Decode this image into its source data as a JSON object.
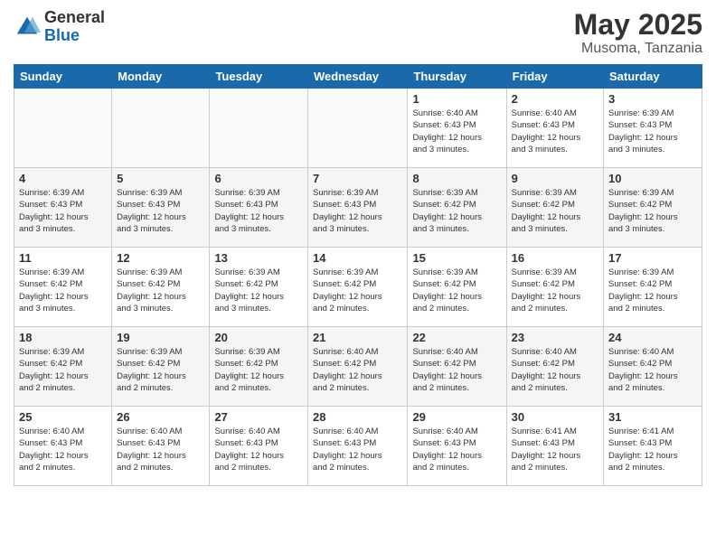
{
  "header": {
    "logo": {
      "general": "General",
      "blue": "Blue"
    },
    "title": "May 2025",
    "location": "Musoma, Tanzania"
  },
  "calendar": {
    "weekdays": [
      "Sunday",
      "Monday",
      "Tuesday",
      "Wednesday",
      "Thursday",
      "Friday",
      "Saturday"
    ],
    "weeks": [
      [
        {
          "day": "",
          "info": ""
        },
        {
          "day": "",
          "info": ""
        },
        {
          "day": "",
          "info": ""
        },
        {
          "day": "",
          "info": ""
        },
        {
          "day": "1",
          "info": "Sunrise: 6:40 AM\nSunset: 6:43 PM\nDaylight: 12 hours\nand 3 minutes."
        },
        {
          "day": "2",
          "info": "Sunrise: 6:40 AM\nSunset: 6:43 PM\nDaylight: 12 hours\nand 3 minutes."
        },
        {
          "day": "3",
          "info": "Sunrise: 6:39 AM\nSunset: 6:43 PM\nDaylight: 12 hours\nand 3 minutes."
        }
      ],
      [
        {
          "day": "4",
          "info": "Sunrise: 6:39 AM\nSunset: 6:43 PM\nDaylight: 12 hours\nand 3 minutes."
        },
        {
          "day": "5",
          "info": "Sunrise: 6:39 AM\nSunset: 6:43 PM\nDaylight: 12 hours\nand 3 minutes."
        },
        {
          "day": "6",
          "info": "Sunrise: 6:39 AM\nSunset: 6:43 PM\nDaylight: 12 hours\nand 3 minutes."
        },
        {
          "day": "7",
          "info": "Sunrise: 6:39 AM\nSunset: 6:43 PM\nDaylight: 12 hours\nand 3 minutes."
        },
        {
          "day": "8",
          "info": "Sunrise: 6:39 AM\nSunset: 6:42 PM\nDaylight: 12 hours\nand 3 minutes."
        },
        {
          "day": "9",
          "info": "Sunrise: 6:39 AM\nSunset: 6:42 PM\nDaylight: 12 hours\nand 3 minutes."
        },
        {
          "day": "10",
          "info": "Sunrise: 6:39 AM\nSunset: 6:42 PM\nDaylight: 12 hours\nand 3 minutes."
        }
      ],
      [
        {
          "day": "11",
          "info": "Sunrise: 6:39 AM\nSunset: 6:42 PM\nDaylight: 12 hours\nand 3 minutes."
        },
        {
          "day": "12",
          "info": "Sunrise: 6:39 AM\nSunset: 6:42 PM\nDaylight: 12 hours\nand 3 minutes."
        },
        {
          "day": "13",
          "info": "Sunrise: 6:39 AM\nSunset: 6:42 PM\nDaylight: 12 hours\nand 3 minutes."
        },
        {
          "day": "14",
          "info": "Sunrise: 6:39 AM\nSunset: 6:42 PM\nDaylight: 12 hours\nand 2 minutes."
        },
        {
          "day": "15",
          "info": "Sunrise: 6:39 AM\nSunset: 6:42 PM\nDaylight: 12 hours\nand 2 minutes."
        },
        {
          "day": "16",
          "info": "Sunrise: 6:39 AM\nSunset: 6:42 PM\nDaylight: 12 hours\nand 2 minutes."
        },
        {
          "day": "17",
          "info": "Sunrise: 6:39 AM\nSunset: 6:42 PM\nDaylight: 12 hours\nand 2 minutes."
        }
      ],
      [
        {
          "day": "18",
          "info": "Sunrise: 6:39 AM\nSunset: 6:42 PM\nDaylight: 12 hours\nand 2 minutes."
        },
        {
          "day": "19",
          "info": "Sunrise: 6:39 AM\nSunset: 6:42 PM\nDaylight: 12 hours\nand 2 minutes."
        },
        {
          "day": "20",
          "info": "Sunrise: 6:39 AM\nSunset: 6:42 PM\nDaylight: 12 hours\nand 2 minutes."
        },
        {
          "day": "21",
          "info": "Sunrise: 6:40 AM\nSunset: 6:42 PM\nDaylight: 12 hours\nand 2 minutes."
        },
        {
          "day": "22",
          "info": "Sunrise: 6:40 AM\nSunset: 6:42 PM\nDaylight: 12 hours\nand 2 minutes."
        },
        {
          "day": "23",
          "info": "Sunrise: 6:40 AM\nSunset: 6:42 PM\nDaylight: 12 hours\nand 2 minutes."
        },
        {
          "day": "24",
          "info": "Sunrise: 6:40 AM\nSunset: 6:42 PM\nDaylight: 12 hours\nand 2 minutes."
        }
      ],
      [
        {
          "day": "25",
          "info": "Sunrise: 6:40 AM\nSunset: 6:43 PM\nDaylight: 12 hours\nand 2 minutes."
        },
        {
          "day": "26",
          "info": "Sunrise: 6:40 AM\nSunset: 6:43 PM\nDaylight: 12 hours\nand 2 minutes."
        },
        {
          "day": "27",
          "info": "Sunrise: 6:40 AM\nSunset: 6:43 PM\nDaylight: 12 hours\nand 2 minutes."
        },
        {
          "day": "28",
          "info": "Sunrise: 6:40 AM\nSunset: 6:43 PM\nDaylight: 12 hours\nand 2 minutes."
        },
        {
          "day": "29",
          "info": "Sunrise: 6:40 AM\nSunset: 6:43 PM\nDaylight: 12 hours\nand 2 minutes."
        },
        {
          "day": "30",
          "info": "Sunrise: 6:41 AM\nSunset: 6:43 PM\nDaylight: 12 hours\nand 2 minutes."
        },
        {
          "day": "31",
          "info": "Sunrise: 6:41 AM\nSunset: 6:43 PM\nDaylight: 12 hours\nand 2 minutes."
        }
      ]
    ]
  }
}
